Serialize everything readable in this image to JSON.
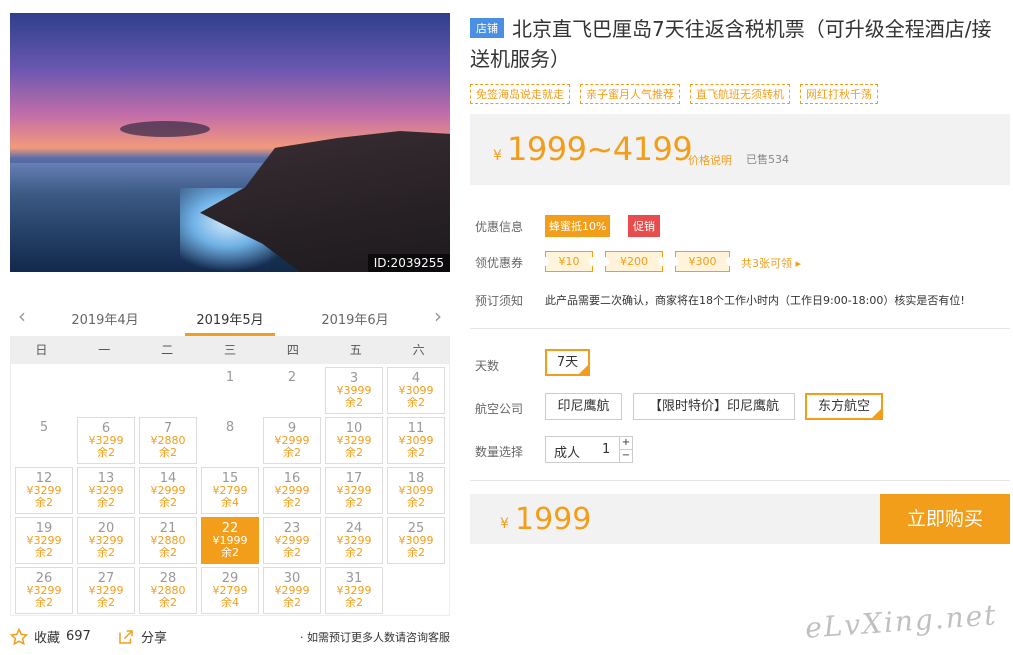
{
  "photo": {
    "id_label": "ID:2039255"
  },
  "calendar": {
    "prev_arrow": "‹",
    "next_arrow": "›",
    "months": [
      "2019年4月",
      "2019年5月",
      "2019年6月"
    ],
    "active_month": 1,
    "weekdays": [
      "日",
      "一",
      "二",
      "三",
      "四",
      "五",
      "六"
    ],
    "days": [
      {
        "num": "1",
        "price": "",
        "left": ""
      },
      {
        "num": "2",
        "price": "",
        "left": ""
      },
      {
        "num": "3",
        "price": "¥3999",
        "left": "余2"
      },
      {
        "num": "4",
        "price": "¥3099",
        "left": "余2"
      },
      {
        "num": "5",
        "price": "",
        "left": ""
      },
      {
        "num": "6",
        "price": "¥3299",
        "left": "余2"
      },
      {
        "num": "7",
        "price": "¥2880",
        "left": "余2"
      },
      {
        "num": "8",
        "price": "",
        "left": ""
      },
      {
        "num": "9",
        "price": "¥2999",
        "left": "余2"
      },
      {
        "num": "10",
        "price": "¥3299",
        "left": "余2"
      },
      {
        "num": "11",
        "price": "¥3099",
        "left": "余2"
      },
      {
        "num": "12",
        "price": "¥3299",
        "left": "余2"
      },
      {
        "num": "13",
        "price": "¥3299",
        "left": "余2"
      },
      {
        "num": "14",
        "price": "¥2999",
        "left": "余2"
      },
      {
        "num": "15",
        "price": "¥2799",
        "left": "余4"
      },
      {
        "num": "16",
        "price": "¥2999",
        "left": "余2"
      },
      {
        "num": "17",
        "price": "¥3299",
        "left": "余2"
      },
      {
        "num": "18",
        "price": "¥3099",
        "left": "余2"
      },
      {
        "num": "19",
        "price": "¥3299",
        "left": "余2"
      },
      {
        "num": "20",
        "price": "¥3299",
        "left": "余2"
      },
      {
        "num": "21",
        "price": "¥2880",
        "left": "余2"
      },
      {
        "num": "22",
        "price": "¥1999",
        "left": "余2",
        "selected": true
      },
      {
        "num": "23",
        "price": "¥2999",
        "left": "余2"
      },
      {
        "num": "24",
        "price": "¥3299",
        "left": "余2"
      },
      {
        "num": "25",
        "price": "¥3099",
        "left": "余2"
      },
      {
        "num": "26",
        "price": "¥3299",
        "left": "余2"
      },
      {
        "num": "27",
        "price": "¥3299",
        "left": "余2"
      },
      {
        "num": "28",
        "price": "¥2880",
        "left": "余2"
      },
      {
        "num": "29",
        "price": "¥2799",
        "left": "余4"
      },
      {
        "num": "30",
        "price": "¥2999",
        "left": "余2"
      },
      {
        "num": "31",
        "price": "¥3299",
        "left": "余2"
      }
    ]
  },
  "social": {
    "fav_label": "收藏",
    "fav_count": "697",
    "share_label": "分享",
    "service_note": "· 如需预订更多人数请咨询客服"
  },
  "product": {
    "shop_tag": "店铺",
    "title": "北京直飞巴厘岛7天往返含税机票（可升级全程酒店/接送机服务）",
    "tags": [
      "免签海岛说走就走",
      "亲子蜜月人气推荐",
      "直飞航班无须转机",
      "网红打秋千荡"
    ],
    "price_currency": "¥",
    "price_range": "1999~4199",
    "price_note": "价格说明",
    "sold": "已售534"
  },
  "offers": {
    "promo_label": "优惠信息",
    "promo_badge": "蜂蜜抵10%",
    "promo_sale": "促销",
    "coupon_label": "领优惠券",
    "coupons": [
      "¥10",
      "¥200",
      "¥300"
    ],
    "coupon_more": "共3张可领 ▸",
    "notice_label": "预订须知",
    "notice_text": "此产品需要二次确认，商家将在18个工作小时内（工作日9:00-18:00）核实是否有位!"
  },
  "options": {
    "days_label": "天数",
    "days_value": "7天",
    "airline_label": "航空公司",
    "airlines": [
      "印尼鹰航",
      "【限时特价】印尼鹰航",
      "东方航空"
    ],
    "selected_airline": 2,
    "qty_label": "数量选择",
    "qty_type": "成人",
    "qty_value": "1",
    "qty_plus": "+",
    "qty_minus": "−"
  },
  "buy": {
    "currency": "¥",
    "total": "1999",
    "button": "立即购买"
  },
  "watermark": "eLvXing.net",
  "colors": {
    "accent": "#f29e1b",
    "sale": "#e84c4c",
    "shop": "#4a90e2"
  }
}
